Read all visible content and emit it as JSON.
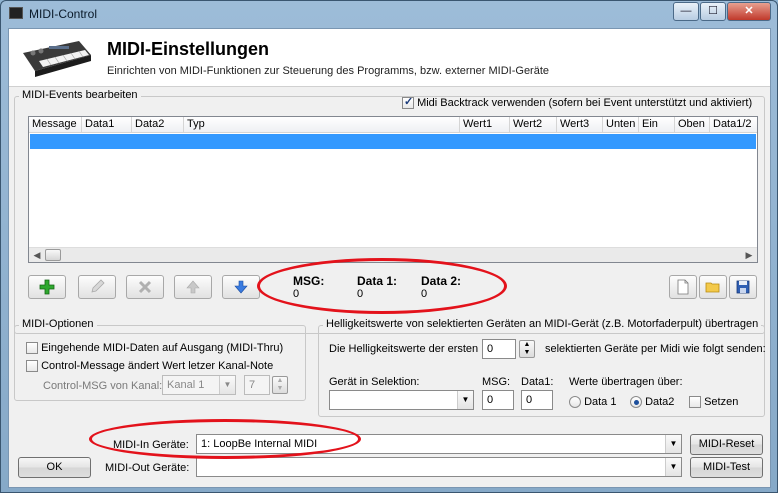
{
  "window": {
    "title": "MIDI-Control",
    "minimize": "—",
    "maximize": "☐",
    "close": "✕"
  },
  "header": {
    "title": "MIDI-Einstellungen",
    "subtitle": "Einrichten von MIDI-Funktionen zur Steuerung des Programms, bzw. externer MIDI-Geräte"
  },
  "events": {
    "group_label": "MIDI-Events bearbeiten",
    "backtrack_label": "Midi Backtrack verwenden (sofern bei Event unterstützt und aktiviert)",
    "backtrack_checked": true,
    "columns": [
      "Message",
      "Data1",
      "Data2",
      "Typ",
      "Wert1",
      "Wert2",
      "Wert3",
      "Unten",
      "Ein",
      "Oben",
      "Data1/2"
    ],
    "toolbar": {
      "add": "add-icon",
      "edit": "pencil-icon",
      "delete": "delete-icon",
      "up": "arrow-up-icon",
      "down": "arrow-down-icon",
      "new": "new-file-icon",
      "open": "folder-icon",
      "save": "save-icon"
    },
    "msg_label": "MSG:",
    "msg_value": "0",
    "data1_label": "Data 1:",
    "data1_value": "0",
    "data2_label": "Data 2:",
    "data2_value": "0"
  },
  "midi_options": {
    "group_label": "MIDI-Optionen",
    "thru_label": "Eingehende MIDI-Daten auf Ausgang (MIDI-Thru)",
    "control_label": "Control-Message ändert Wert letzer Kanal-Note",
    "control_msg_label": "Control-MSG von Kanal:",
    "kanal_value": "Kanal 1",
    "kanal_number": "7"
  },
  "brightness": {
    "group_label": "Helligkeitswerte von selektierten Geräten an MIDI-Gerät (z.B. Motorfaderpult) übertragen",
    "first_label": "Die Helligkeitswerte der ersten",
    "first_value": "0",
    "send_label": "selektierten Geräte per Midi wie folgt senden:",
    "device_label": "Gerät in Selektion:",
    "device_value": "",
    "msg_label": "MSG:",
    "msg_value": "0",
    "data1_label": "Data1:",
    "data1_value": "0",
    "transfer_label": "Werte übertragen über:",
    "radio_data1": "Data 1",
    "radio_data2": "Data2",
    "setzen_label": "Setzen"
  },
  "devices": {
    "in_label": "MIDI-In Geräte:",
    "in_value": "1: LoopBe Internal MIDI",
    "out_label": "MIDI-Out Geräte:",
    "out_value": "",
    "reset_label": "MIDI-Reset",
    "test_label": "MIDI-Test",
    "ok_label": "OK"
  },
  "colors": {
    "selection": "#3399ff",
    "annotation": "#e3121b"
  }
}
